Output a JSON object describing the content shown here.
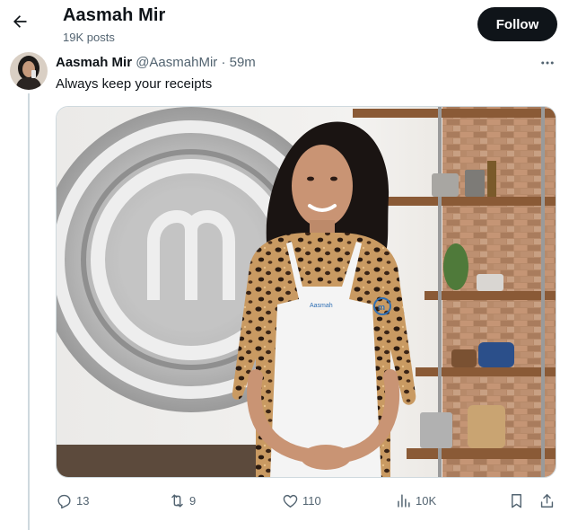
{
  "header": {
    "name": "Aasmah Mir",
    "posts_count": "19K posts",
    "follow_label": "Follow"
  },
  "tweet": {
    "author_name": "Aasmah Mir",
    "author_handle": "@AasmahMir",
    "separator": "·",
    "time": "59m",
    "text": "Always keep your receipts",
    "media": {
      "apron_name": "Aasmah"
    }
  },
  "actions": {
    "replies": "13",
    "reposts": "9",
    "likes": "110",
    "views": "10K"
  },
  "icons": [
    "back-arrow-icon",
    "more-icon",
    "reply-icon",
    "repost-icon",
    "like-icon",
    "views-icon",
    "bookmark-icon",
    "share-icon"
  ],
  "colors": {
    "text_primary": "#0f1419",
    "text_secondary": "#536471",
    "follow_bg": "#0f1419",
    "thread_line": "#cfd9de"
  }
}
